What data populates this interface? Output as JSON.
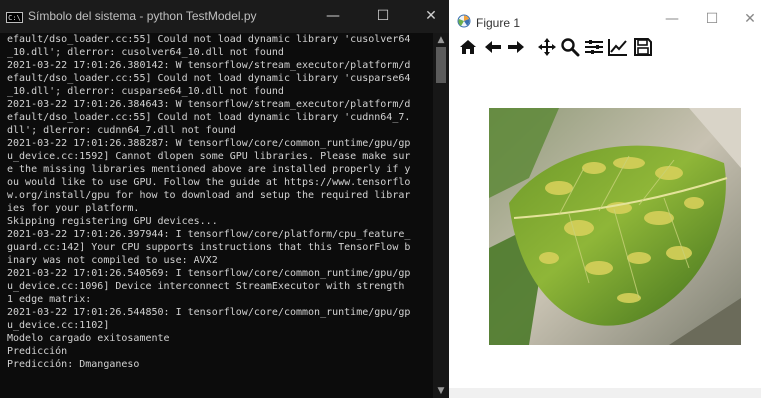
{
  "console": {
    "title": "Símbolo del sistema - python  TestModel.py",
    "title_icon_text": "C:\\",
    "controls": {
      "minimize": "—",
      "maximize": "☐",
      "close": "✕"
    },
    "lines": [
      "efault/dso_loader.cc:55] Could not load dynamic library 'cusolver64",
      "_10.dll'; dlerror: cusolver64_10.dll not found",
      "2021-03-22 17:01:26.380142: W tensorflow/stream_executor/platform/d",
      "efault/dso_loader.cc:55] Could not load dynamic library 'cusparse64",
      "_10.dll'; dlerror: cusparse64_10.dll not found",
      "2021-03-22 17:01:26.384643: W tensorflow/stream_executor/platform/d",
      "efault/dso_loader.cc:55] Could not load dynamic library 'cudnn64_7.",
      "dll'; dlerror: cudnn64_7.dll not found",
      "2021-03-22 17:01:26.388287: W tensorflow/core/common_runtime/gpu/gp",
      "u_device.cc:1592] Cannot dlopen some GPU libraries. Please make sur",
      "e the missing libraries mentioned above are installed properly if y",
      "ou would like to use GPU. Follow the guide at https://www.tensorflo",
      "w.org/install/gpu for how to download and setup the required librar",
      "ies for your platform.",
      "Skipping registering GPU devices...",
      "2021-03-22 17:01:26.397944: I tensorflow/core/platform/cpu_feature_",
      "guard.cc:142] Your CPU supports instructions that this TensorFlow b",
      "inary was not compiled to use: AVX2",
      "2021-03-22 17:01:26.540569: I tensorflow/core/common_runtime/gpu/gp",
      "u_device.cc:1096] Device interconnect StreamExecutor with strength",
      "1 edge matrix:",
      "2021-03-22 17:01:26.544850: I tensorflow/core/common_runtime/gpu/gp",
      "u_device.cc:1102]",
      "Modelo cargado exitosamente",
      "Predicción",
      "Predicción: Dmanganeso"
    ],
    "scroll_up": "▲",
    "scroll_down": "▼",
    "colors": {
      "background": "#0c0c0c",
      "text": "#d2d2d2",
      "titlebar": "#1b1b1b"
    }
  },
  "figure": {
    "title": "Figure 1",
    "controls": {
      "minimize": "—",
      "maximize": "☐",
      "close": "✕"
    },
    "toolbar": [
      {
        "name": "home-icon"
      },
      {
        "name": "back-arrow-icon"
      },
      {
        "name": "forward-arrow-icon"
      },
      {
        "name": "pan-icon"
      },
      {
        "name": "zoom-icon"
      },
      {
        "name": "subplots-icon"
      },
      {
        "name": "edit-axis-icon"
      },
      {
        "name": "save-icon"
      }
    ],
    "image_subject": "leaf-with-yellow-mottling"
  }
}
